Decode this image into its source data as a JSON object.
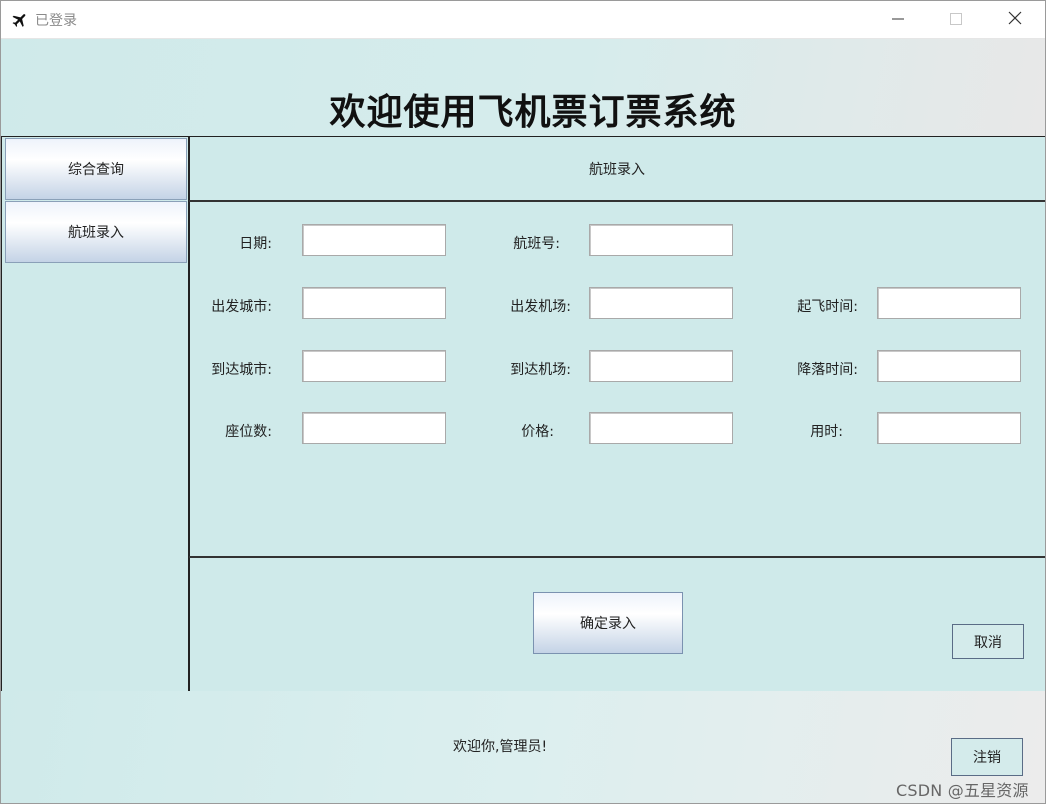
{
  "window": {
    "title": "已登录"
  },
  "header": {
    "title": "欢迎使用飞机票订票系统"
  },
  "sidebar": {
    "items": [
      {
        "label": "综合查询"
      },
      {
        "label": "航班录入"
      }
    ]
  },
  "section": {
    "title": "航班录入"
  },
  "form": {
    "date_label": "日期:",
    "flight_no_label": "航班号:",
    "depart_city_label": "出发城市:",
    "depart_airport_label": "出发机场:",
    "takeoff_time_label": "起飞时间:",
    "arrive_city_label": "到达城市:",
    "arrive_airport_label": "到达机场:",
    "landing_time_label": "降落时间:",
    "seats_label": "座位数:",
    "price_label": "价格:",
    "duration_label": "用时:",
    "values": {
      "date": "",
      "flight_no": "",
      "depart_city": "",
      "depart_airport": "",
      "takeoff_time": "",
      "arrive_city": "",
      "arrive_airport": "",
      "landing_time": "",
      "seats": "",
      "price": "",
      "duration": ""
    }
  },
  "actions": {
    "confirm_label": "确定录入",
    "cancel_label": "取消"
  },
  "footer": {
    "welcome": "欢迎你,管理员!",
    "logout_label": "注销"
  },
  "watermark": "CSDN @五星资源",
  "icons": {
    "app": "airplane-icon",
    "minimize": "minimize-icon",
    "maximize": "maximize-icon",
    "close": "close-icon"
  }
}
